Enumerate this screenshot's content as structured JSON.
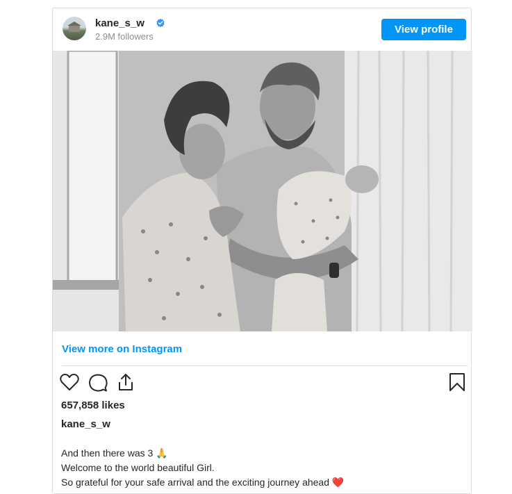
{
  "post": {
    "username": "kane_s_w",
    "followers": "2.9M followers",
    "view_profile_label": "View profile",
    "view_more_label": "View more on Instagram",
    "likes": "657,858 likes",
    "caption_username": "kane_s_w",
    "caption_lines": [
      "And then there was 3 🙏",
      "Welcome to the world beautiful Girl.",
      "So grateful for your safe arrival and the exciting journey ahead ❤️"
    ]
  },
  "icons": {
    "verified": "verified-badge-icon",
    "like": "heart-icon",
    "comment": "comment-icon",
    "share": "share-icon",
    "save": "bookmark-icon"
  },
  "colors": {
    "accent": "#0095f6",
    "text": "#262626",
    "muted": "#8e8e8e",
    "border": "#dbdbdb"
  }
}
